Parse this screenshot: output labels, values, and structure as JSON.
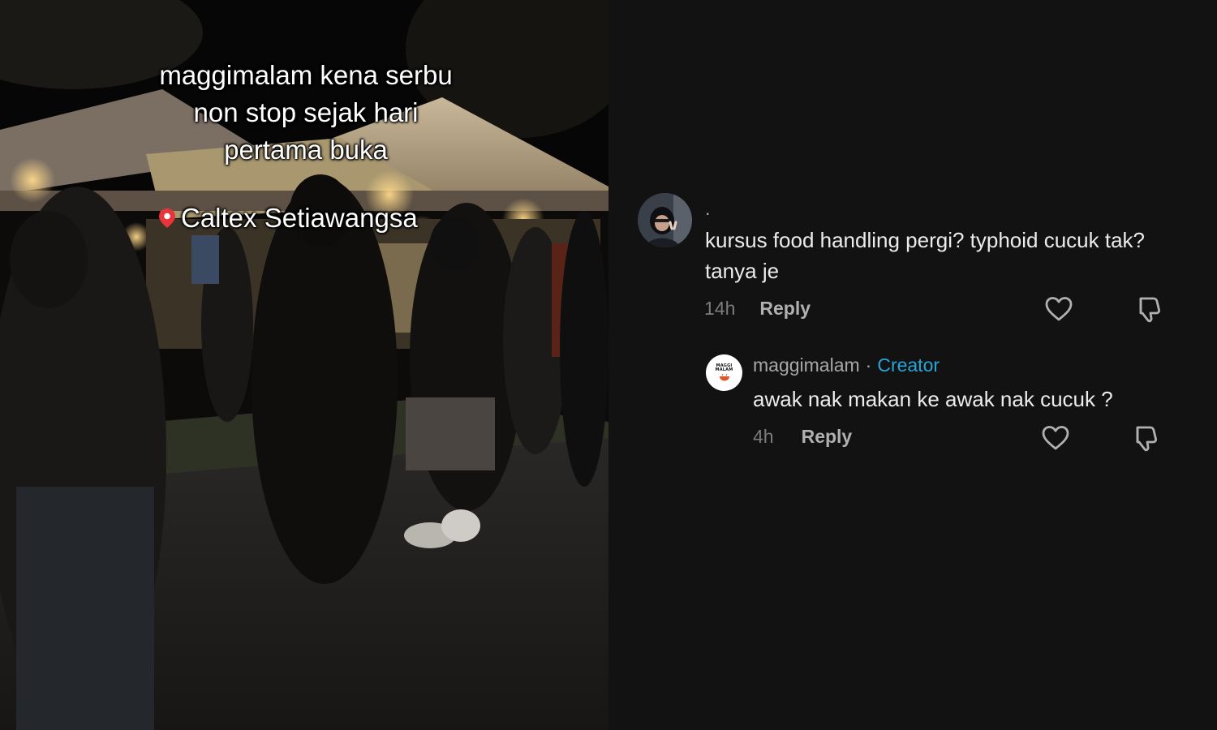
{
  "video": {
    "caption_lines": [
      "maggimalam kena serbu",
      "non stop sejak hari",
      "pertama buka"
    ],
    "location_icon": "location-pin-icon",
    "location": "Caltex Setiawangsa"
  },
  "comments": [
    {
      "username": ".",
      "text": "kursus food handling pergi? typhoid cucuk tak? tanya je",
      "time": "14h",
      "reply_label": "Reply",
      "like_icon": "heart-icon",
      "dislike_icon": "thumbs-down-icon",
      "reply": {
        "username": "maggimalam",
        "separator": "·",
        "badge": "Creator",
        "avatar_logo_lines": [
          "MAGGI",
          "MALAM"
        ],
        "text": "awak nak makan ke awak nak cucuk ?",
        "time": "4h",
        "reply_label": "Reply",
        "like_icon": "heart-icon",
        "dislike_icon": "thumbs-down-icon"
      }
    }
  ],
  "colors": {
    "background": "#121212",
    "creator_badge": "#26a6d6",
    "comment_text": "#ececec",
    "muted_text": "#a8a8a8"
  }
}
